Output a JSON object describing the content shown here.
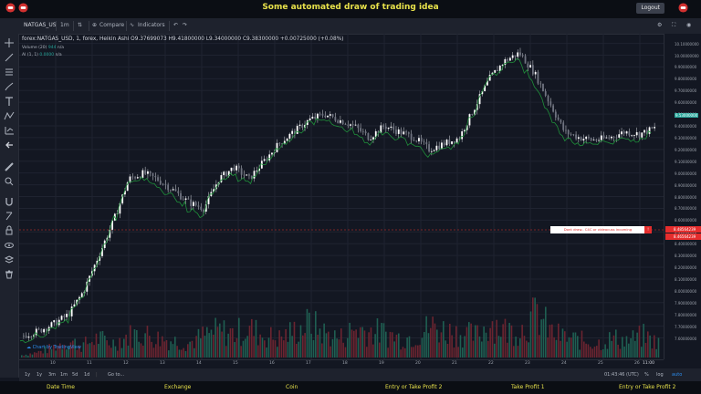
{
  "header": {
    "title": "Some automated draw of trading idea",
    "logout_label": "Logout"
  },
  "toolbar": {
    "symbol": "NATGAS_US",
    "interval": "1m",
    "compare_label": "Compare",
    "indicators_label": "Indicators"
  },
  "legend": {
    "main": "forex:NATGAS_USD, 1, forex, Heikin Ashi",
    "open": "O9.37699073",
    "high": "H9.41800000",
    "low": "L9.34000000",
    "close": "C9.38300000",
    "change": "+0.00725000 (+0.08%)",
    "volume_label": "Volume (20)",
    "volume_value": "944",
    "volume_na": "n/a",
    "ai_label": "AI (1, 1)",
    "ai_value": "0.0000",
    "ai_na": "n/a"
  },
  "price_axis": {
    "labels": [
      "10.10000000",
      "10.00000000",
      "9.90000000",
      "9.80000000",
      "9.70000000",
      "9.60000000",
      "9.50000000",
      "9.40000000",
      "9.30000000",
      "9.20000000",
      "9.10000000",
      "9.00000000",
      "8.90000000",
      "8.80000000",
      "8.70000000",
      "8.60000000",
      "8.50000000",
      "8.40000000",
      "8.30000000",
      "8.20000000",
      "8.10000000",
      "8.00000000",
      "7.90000000",
      "7.80000000",
      "7.70000000",
      "7.60000000"
    ],
    "current_price": "9.53000000",
    "marker_top": "8.48564239",
    "marker_bottom": "8.46564239"
  },
  "notice": {
    "text": "Dont draw.. C4C or videocuss incoming",
    "close": "!"
  },
  "time_axis": {
    "labels": [
      "10",
      "11",
      "12",
      "13",
      "14",
      "15",
      "16",
      "17",
      "18",
      "19",
      "20",
      "21",
      "22",
      "23",
      "24",
      "25",
      "26"
    ],
    "last": "11:00"
  },
  "bottom": {
    "ranges": [
      "1y",
      "1y",
      "3m",
      "1m",
      "5d",
      "1d"
    ],
    "goto": "Go to...",
    "clock": "01:43:46 (UTC)",
    "percent": "%",
    "log": "log",
    "auto": "auto"
  },
  "watermark": "Chart by TradingView",
  "footer": {
    "items": [
      "Date Time",
      "Exchange",
      "Coin",
      "Entry or Take Profit 2",
      "Take Profit 1",
      "Entry or Take Profit 2"
    ]
  },
  "chart_data": {
    "type": "candlestick",
    "series_style": "Heikin Ashi",
    "symbol": "forex:NATGAS_USD",
    "x_labels": [
      "10",
      "11",
      "12",
      "13",
      "14",
      "15",
      "16",
      "17",
      "18",
      "19",
      "20",
      "21",
      "22",
      "23",
      "24",
      "25",
      "26"
    ],
    "ylim": [
      7.55,
      10.12
    ],
    "close_path": [
      7.62,
      7.66,
      7.72,
      7.8,
      8.0,
      8.3,
      8.6,
      8.95,
      9.0,
      8.94,
      8.85,
      8.75,
      8.7,
      8.95,
      9.05,
      8.95,
      9.1,
      9.25,
      9.35,
      9.45,
      9.5,
      9.45,
      9.4,
      9.3,
      9.4,
      9.35,
      9.3,
      9.2,
      9.25,
      9.3,
      9.55,
      9.8,
      9.95,
      10.02,
      9.85,
      9.6,
      9.35,
      9.3,
      9.28,
      9.3,
      9.35,
      9.33,
      9.38
    ],
    "volume_spikes": [
      0.05,
      0.1,
      0.2,
      0.35,
      0.25,
      0.4,
      0.3,
      0.45,
      0.5,
      0.4,
      0.35,
      0.3,
      0.45,
      0.55,
      0.5,
      0.6,
      0.45,
      0.4,
      0.55,
      0.7,
      0.5,
      0.4,
      0.6,
      0.55,
      0.5,
      0.4,
      0.45,
      0.65,
      0.55,
      0.5,
      0.45,
      0.75,
      0.55,
      0.6,
      0.9,
      0.5,
      0.4,
      0.35,
      0.3,
      0.4,
      0.35,
      0.45,
      0.3
    ]
  }
}
